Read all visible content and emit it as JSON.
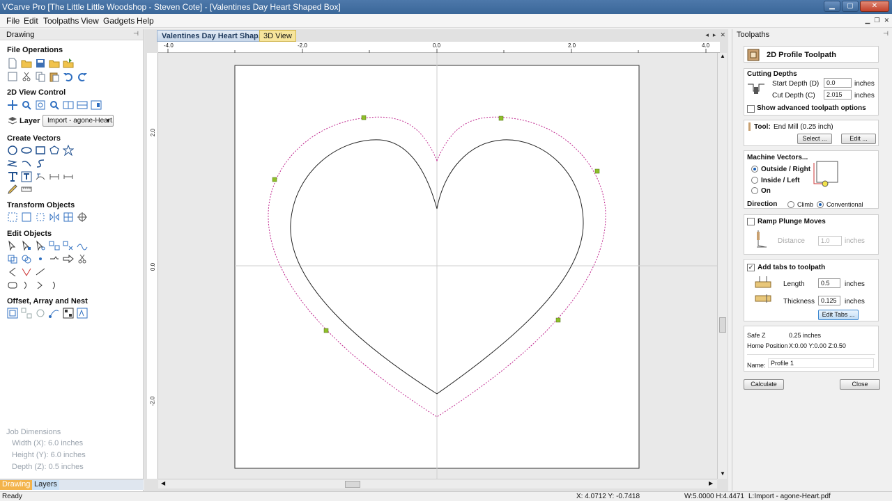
{
  "window": {
    "title": "VCarve Pro [The Little Little Woodshop - Steven Cote] - [Valentines Day Heart Shaped Box]"
  },
  "menu": [
    "File",
    "Edit",
    "Toolpaths",
    "View",
    "Gadgets",
    "Help"
  ],
  "left_panel": {
    "header": "Drawing",
    "sections": {
      "file_ops": "File Operations",
      "view_control": "2D View Control",
      "create_vectors": "Create Vectors",
      "transform": "Transform Objects",
      "edit_objects": "Edit Objects",
      "offset": "Offset, Array and Nest"
    },
    "layer_label": "Layer",
    "layer_value": "Import - agone-Heart.",
    "job_dimensions": {
      "title": "Job Dimensions",
      "width": "Width  (X): 6.0 inches",
      "height": "Height (Y): 6.0 inches",
      "depth": "Depth  (Z): 0.5 inches"
    },
    "bottom_tabs": [
      "Drawing",
      "Layers"
    ]
  },
  "document": {
    "tabs": [
      "Valentines Day Heart Shap...",
      "3D View"
    ],
    "ruler_top": [
      "-4.0",
      "-2.0",
      "0.0",
      "2.0",
      "4.0"
    ],
    "ruler_left": [
      "2.0",
      "0.0",
      "-2.0"
    ]
  },
  "toolpaths_panel": {
    "header": "Toolpaths",
    "title": "2D Profile Toolpath",
    "cutting_depths": "Cutting Depths",
    "start_depth_label": "Start Depth (D)",
    "start_depth": "0.0",
    "cut_depth_label": "Cut Depth (C)",
    "cut_depth": "2.015",
    "units": "inches",
    "show_advanced": "Show advanced toolpath options",
    "tool_label": "Tool:",
    "tool_value": "End Mill (0.25 inch)",
    "select_btn": "Select ...",
    "edit_btn": "Edit ...",
    "machine_vectors": "Machine Vectors...",
    "outside_right": "Outside / Right",
    "inside_left": "Inside / Left",
    "on": "On",
    "direction": "Direction",
    "climb": "Climb",
    "conventional": "Conventional",
    "ramp": "Ramp Plunge Moves",
    "distance_label": "Distance",
    "distance_value": "1.0",
    "add_tabs": "Add tabs to toolpath",
    "length_label": "Length",
    "length_value": "0.5",
    "thickness_label": "Thickness",
    "thickness_value": "0.125",
    "edit_tabs_btn": "Edit Tabs ...",
    "safe_z_label": "Safe Z",
    "safe_z_value": "0.25 inches",
    "home_label": "Home Position",
    "home_value": "X:0.00 Y:0.00 Z:0.50",
    "name_label": "Name:",
    "name_value": "Profile 1",
    "calculate_btn": "Calculate",
    "close_btn": "Close"
  },
  "status": {
    "ready": "Ready",
    "coords": "X: 4.0712 Y: -0.7418",
    "wh": "W:5.0000   H:4.4471",
    "layer": "L:Import - agone-Heart.pdf"
  },
  "colors": {
    "titlebar": "#3a6799",
    "toolpath": "#c0288f",
    "node": "#8fbf2a",
    "active_tab": "#f3b34a"
  }
}
